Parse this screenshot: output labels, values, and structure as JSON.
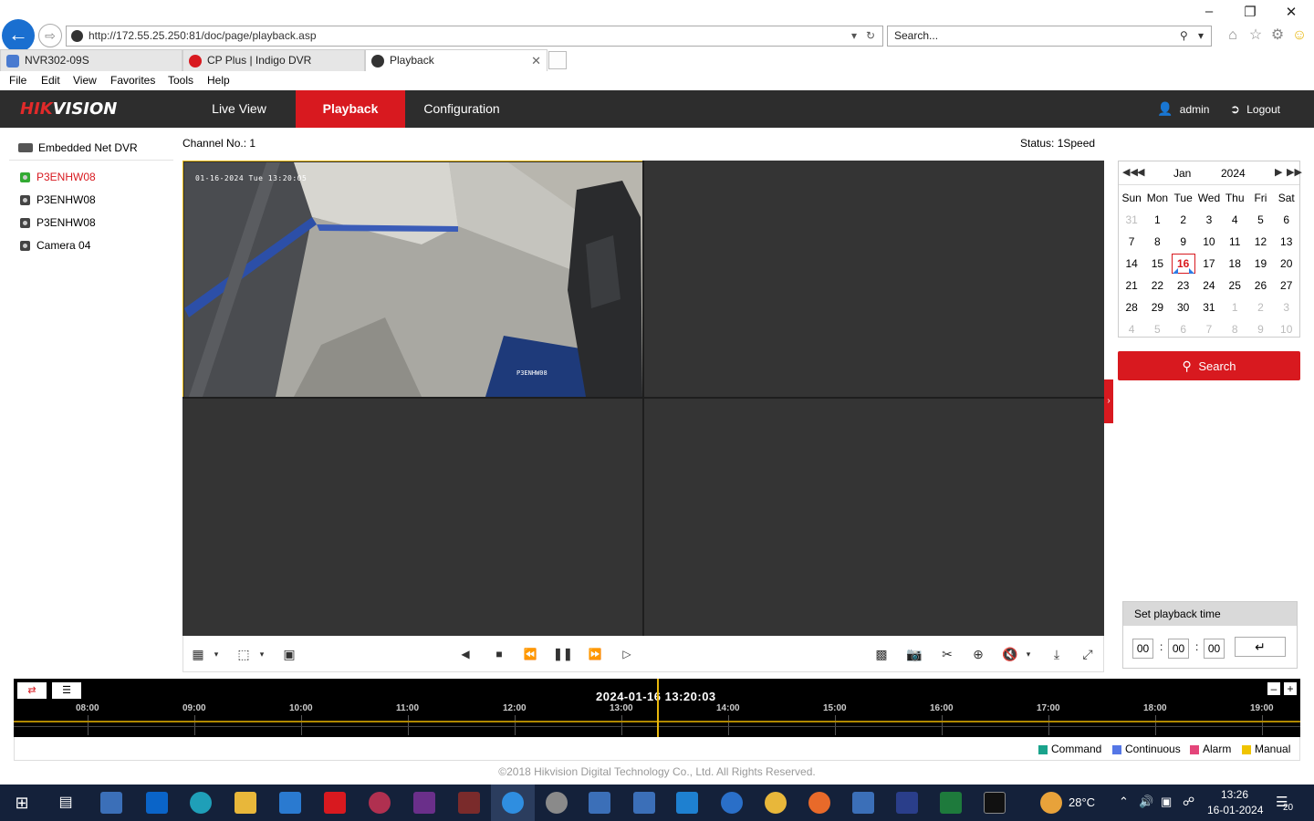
{
  "browser": {
    "url": "http://172.55.25.250:81/doc/page/playback.asp",
    "search_placeholder": "Search...",
    "tabs": [
      {
        "label": "NVR302-09S"
      },
      {
        "label": "CP Plus | Indigo DVR"
      },
      {
        "label": "Playback"
      }
    ],
    "menu": [
      "File",
      "Edit",
      "View",
      "Favorites",
      "Tools",
      "Help"
    ]
  },
  "header": {
    "logo_a": "HIK",
    "logo_b": "VISION",
    "nav": [
      "Live View",
      "Playback",
      "Configuration"
    ],
    "active_nav": "Playback",
    "user": "admin",
    "logout": "Logout"
  },
  "tree": {
    "root": "Embedded Net DVR",
    "channels": [
      "P3ENHW08",
      "P3ENHW08",
      "P3ENHW08",
      "Camera 04"
    ],
    "selected_index": 0
  },
  "player": {
    "channel_label": "Channel No.: 1",
    "status_label": "Status: 1Speed",
    "osd_timestamp": "01-16-2024 Tue 13:20:05",
    "osd_name": "P3ENHW08"
  },
  "calendar": {
    "month": "Jan",
    "year": "2024",
    "weekdays": [
      "Sun",
      "Mon",
      "Tue",
      "Wed",
      "Thu",
      "Fri",
      "Sat"
    ],
    "weeks": [
      [
        "31",
        "1",
        "2",
        "3",
        "4",
        "5",
        "6"
      ],
      [
        "7",
        "8",
        "9",
        "10",
        "11",
        "12",
        "13"
      ],
      [
        "14",
        "15",
        "16",
        "17",
        "18",
        "19",
        "20"
      ],
      [
        "21",
        "22",
        "23",
        "24",
        "25",
        "26",
        "27"
      ],
      [
        "28",
        "29",
        "30",
        "31",
        "1",
        "2",
        "3"
      ],
      [
        "4",
        "5",
        "6",
        "7",
        "8",
        "9",
        "10"
      ]
    ],
    "today": "16"
  },
  "search_button": "Search",
  "playback_time": {
    "title": "Set playback time",
    "hh": "00",
    "mm": "00",
    "ss": "00"
  },
  "timeline": {
    "current": "2024-01-16 13:20:03",
    "hours": [
      "08:00",
      "09:00",
      "10:00",
      "11:00",
      "12:00",
      "13:00",
      "14:00",
      "15:00",
      "16:00",
      "17:00",
      "18:00",
      "19:00"
    ]
  },
  "legend": [
    {
      "label": "Command",
      "color": "#1aa38c"
    },
    {
      "label": "Continuous",
      "color": "#5577e6"
    },
    {
      "label": "Alarm",
      "color": "#e4457a"
    },
    {
      "label": "Manual",
      "color": "#f0c400"
    }
  ],
  "footer": "©2018 Hikvision Digital Technology Co., Ltd. All Rights Reserved.",
  "taskbar": {
    "weather": "28°C",
    "time": "13:26",
    "date": "16-01-2024",
    "notifications": "20"
  }
}
